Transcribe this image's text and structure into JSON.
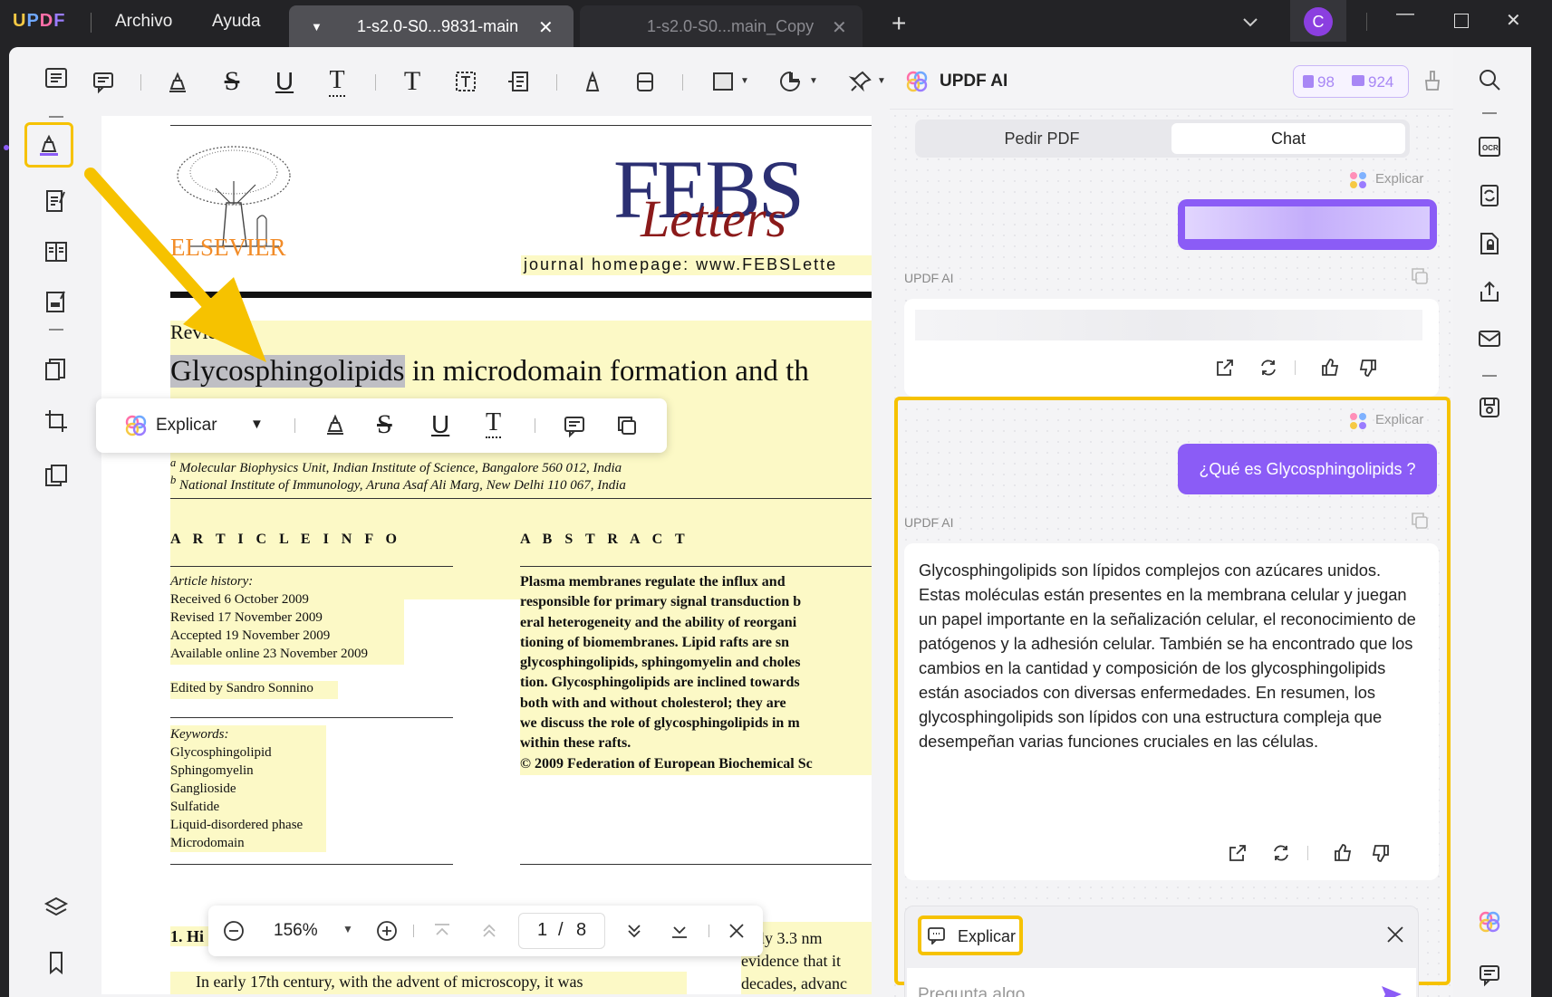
{
  "app": {
    "logo": "UPDF"
  },
  "menu": {
    "file": "Archivo",
    "help": "Ayuda"
  },
  "tabs": [
    {
      "label": "1-s2.0-S0...9831-main",
      "active": true
    },
    {
      "label": "1-s2.0-S0...main_Copy",
      "active": false
    }
  ],
  "user": {
    "initial": "C",
    "avatar_color": "#8b3fe0"
  },
  "floating_toolbar": {
    "explain_label": "Explicar"
  },
  "pdf": {
    "journal": "FEBS",
    "journal_sub": "Letters",
    "publisher": "ELSEVIER",
    "homepage": "journal homepage: www.FEBSLette",
    "section": "Review",
    "title_highlight": "Glycosphingolipids",
    "title_rest": " in microdomain formation and th",
    "affil_a": "Molecular Biophysics Unit, Indian Institute of Science, Bangalore 560 012, India",
    "affil_b": "National Institute of Immunology, Aruna Asaf Ali Marg, New Delhi 110 067, India",
    "article_info_heading": "A R T I C L E   I N F O",
    "history_heading": "Article history:",
    "history": [
      "Received 6 October 2009",
      "Revised 17 November 2009",
      "Accepted 19 November 2009",
      "Available online 23 November 2009"
    ],
    "edited_by": "Edited by Sandro Sonnino",
    "keywords_heading": "Keywords:",
    "keywords": [
      "Glycosphingolipid",
      "Sphingomyelin",
      "Ganglioside",
      "Sulfatide",
      "Liquid-disordered phase",
      "Microdomain"
    ],
    "abstract_heading": "A B S T R A C T",
    "abstract_lines": [
      "Plasma membranes regulate the influx and",
      "responsible for primary signal transduction b",
      "eral heterogeneity and the ability of reorgani",
      "tioning of biomembranes. Lipid rafts are sn",
      "glycosphingolipids, sphingomyelin and choles",
      "tion. Glycosphingolipids are inclined towards",
      "both with and without cholesterol; they are",
      "we discuss the role of glycosphingolipids in m",
      "within these rafts.",
      "© 2009 Federation of European Biochemical Sc"
    ],
    "intro_heading": "1. Hi",
    "intro_line": "In early 17th century, with the advent of microscopy, it was",
    "right_lines": [
      "ately 3.3 nm",
      "evidence that it",
      "decades, advanc"
    ]
  },
  "bottom_bar": {
    "zoom": "156%",
    "page_current": "1",
    "page_sep": "/",
    "page_total": "8"
  },
  "ai": {
    "title": "UPDF AI",
    "pdf_count": "98",
    "chat_count": "924",
    "tab_ask_pdf": "Pedir PDF",
    "tab_chat": "Chat",
    "explain_tag": "Explicar",
    "updf_ai_label": "UPDF AI",
    "user_question": "¿Qué es Glycosphingolipids ?",
    "answer": "Glycosphingolipids son lípidos complejos con azúcares unidos. Estas moléculas están presentes en la membrana celular y juegan un papel importante en la señalización celular, el reconocimiento de patógenos y la adhesión celular. También se ha encontrado que los cambios en la cantidad y composición de los glycosphingolipids están asociados con diversas enfermedades. En resumen, los glycosphingolipids son lípidos con una estructura compleja que desempeñan varias funciones cruciales en las células.",
    "prompt_chip": "Explicar",
    "input_placeholder": "Pregunta algo"
  },
  "colors": {
    "accent": "#8b5cf6",
    "highlight": "#f6c200",
    "pdf_highlight": "#fcf9c6"
  }
}
